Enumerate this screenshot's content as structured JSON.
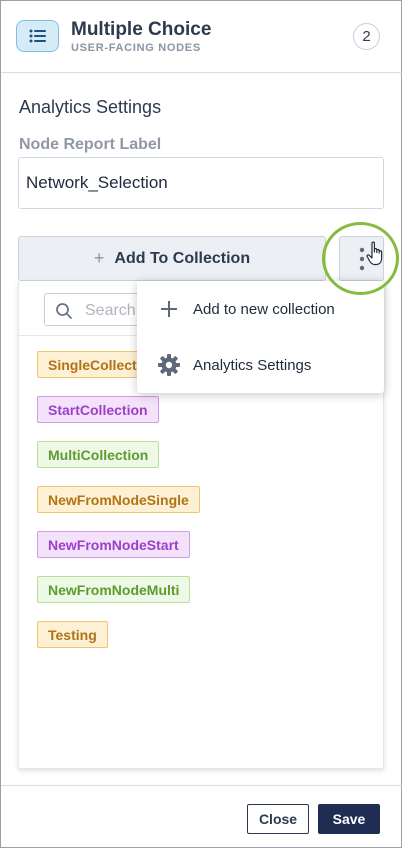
{
  "header": {
    "title": "Multiple Choice",
    "subtitle": "USER-FACING NODES",
    "count": "2",
    "node_icon": "list-icon"
  },
  "main": {
    "section_title": "Analytics Settings",
    "field_label": "Node Report Label",
    "field_value": "Network_Selection",
    "add_button_label": "Add To Collection",
    "more_button_icon": "vertical-dots-icon"
  },
  "collections": {
    "search_placeholder": "Search",
    "tags": [
      {
        "label": "SingleCollection",
        "color": "#f2c46e"
      },
      {
        "label": "StartCollection",
        "color": "#d39be8"
      },
      {
        "label": "MultiCollection",
        "color": "#b8df96"
      },
      {
        "label": "NewFromNodeSingle",
        "color": "#f2c46e"
      },
      {
        "label": "NewFromNodeStart",
        "color": "#d39be8"
      },
      {
        "label": "NewFromNodeMulti",
        "color": "#b8df96"
      },
      {
        "label": "Testing",
        "color": "#f2c46e"
      }
    ]
  },
  "menu": {
    "items": [
      {
        "label": "Add to new collection",
        "icon": "plus-icon"
      },
      {
        "label": "Analytics Settings",
        "icon": "gear-icon"
      }
    ]
  },
  "footer": {
    "close_label": "Close",
    "save_label": "Save"
  },
  "colors": {
    "highlight": "#86bc3e",
    "primary": "#1f2d52"
  }
}
